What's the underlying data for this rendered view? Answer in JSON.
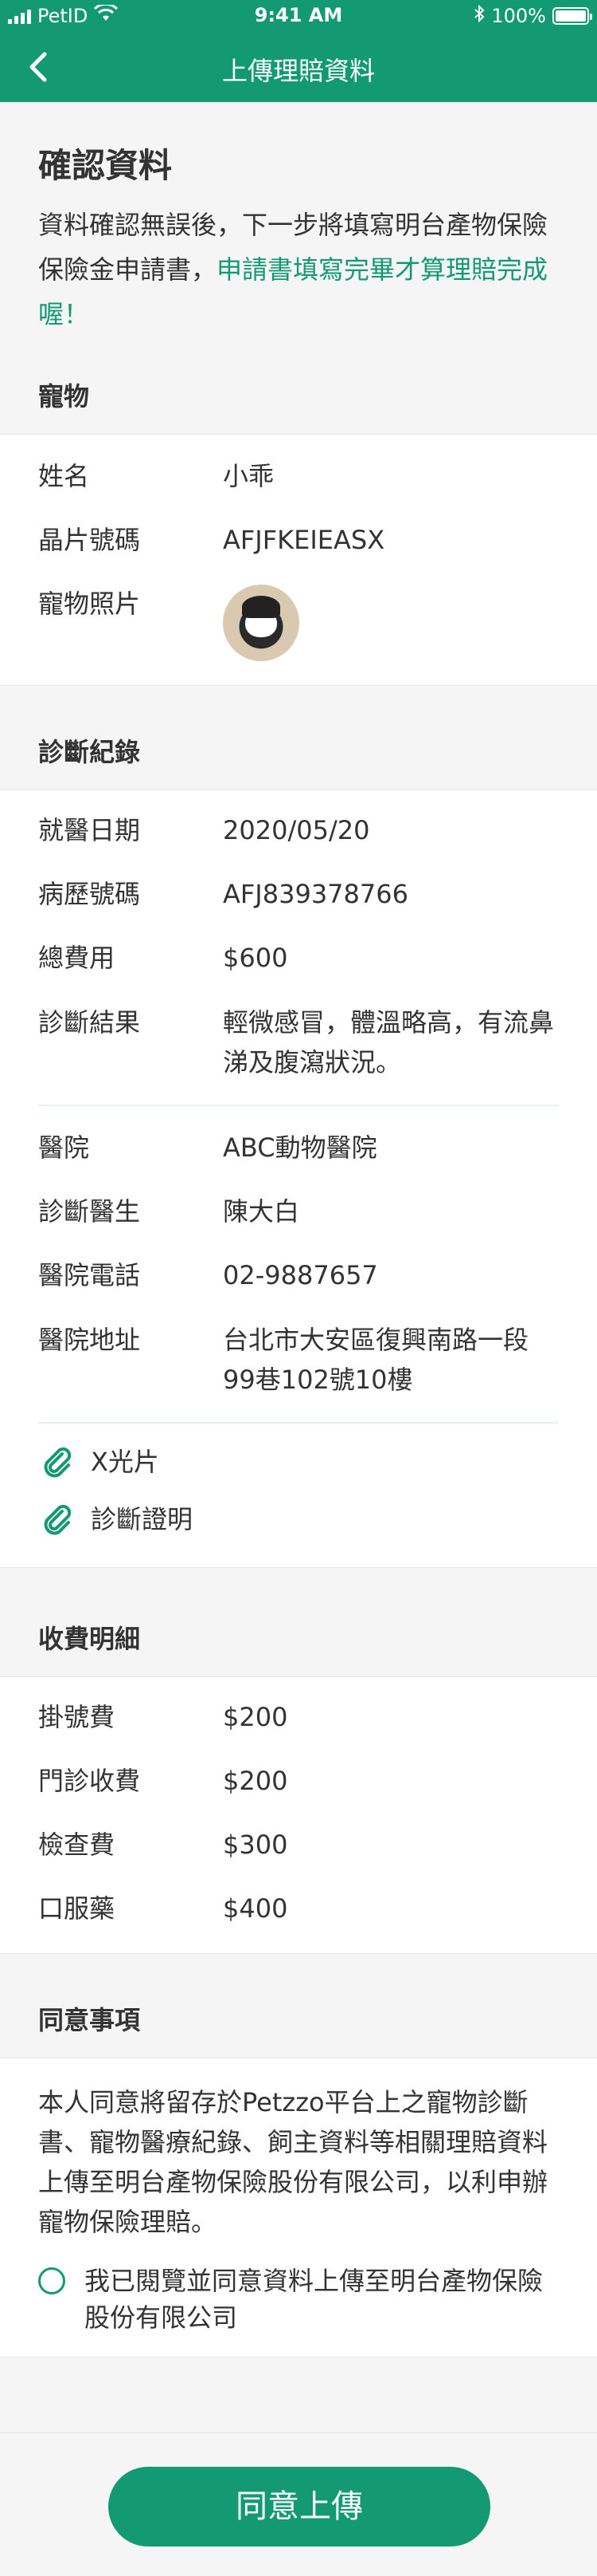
{
  "status_bar": {
    "carrier": "PetID",
    "time": "9:41 AM",
    "battery": "100%",
    "battery_level": 1.0
  },
  "nav": {
    "title": "上傳理賠資料"
  },
  "intro": {
    "heading": "確認資料",
    "text": "資料確認無誤後，下一步將填寫明台產物保險保險金申請書，",
    "highlight": "申請書填寫完畢才算理賠完成喔！"
  },
  "pet": {
    "section_title": "寵物",
    "rows": [
      {
        "label": "姓名",
        "value": "小乖"
      },
      {
        "label": "晶片號碼",
        "value": "AFJFKEIEASX"
      },
      {
        "label": "寵物照片",
        "value": ""
      }
    ]
  },
  "diagnosis": {
    "section_title": "診斷紀錄",
    "rows": [
      {
        "label": "就醫日期",
        "value": "2020/05/20"
      },
      {
        "label": "病歷號碼",
        "value": "AFJ839378766"
      },
      {
        "label": "總費用",
        "value": "$600"
      },
      {
        "label": "診斷結果",
        "value": "輕微感冒，體溫略高，有流鼻涕及腹瀉狀況。"
      }
    ],
    "hospital_rows": [
      {
        "label": "醫院",
        "value": "ABC動物醫院"
      },
      {
        "label": "診斷醫生",
        "value": "陳大白"
      },
      {
        "label": "醫院電話",
        "value": "02-9887657"
      },
      {
        "label": "醫院地址",
        "value": "台北市大安區復興南路一段99巷102號10樓"
      }
    ],
    "attachments": [
      "X光片",
      "診斷證明"
    ]
  },
  "fees": {
    "section_title": "收費明細",
    "rows": [
      {
        "label": "掛號費",
        "value": "$200"
      },
      {
        "label": "門診收費",
        "value": "$200"
      },
      {
        "label": "檢查費",
        "value": "$300"
      },
      {
        "label": "口服藥",
        "value": "$400"
      }
    ]
  },
  "consent": {
    "section_title": "同意事項",
    "text": "本人同意將留存於Petzzo平台上之寵物診斷書、寵物醫療紀錄、飼主資料等相關理賠資料上傳至明台產物保險股份有限公司，以利申辦寵物保險理賠。",
    "checkbox_label": "我已閱覽並同意資料上傳至明台產物保險股份有限公司",
    "checked": false
  },
  "footer": {
    "submit_label": "同意上傳"
  },
  "colors": {
    "brand": "#149a73"
  }
}
